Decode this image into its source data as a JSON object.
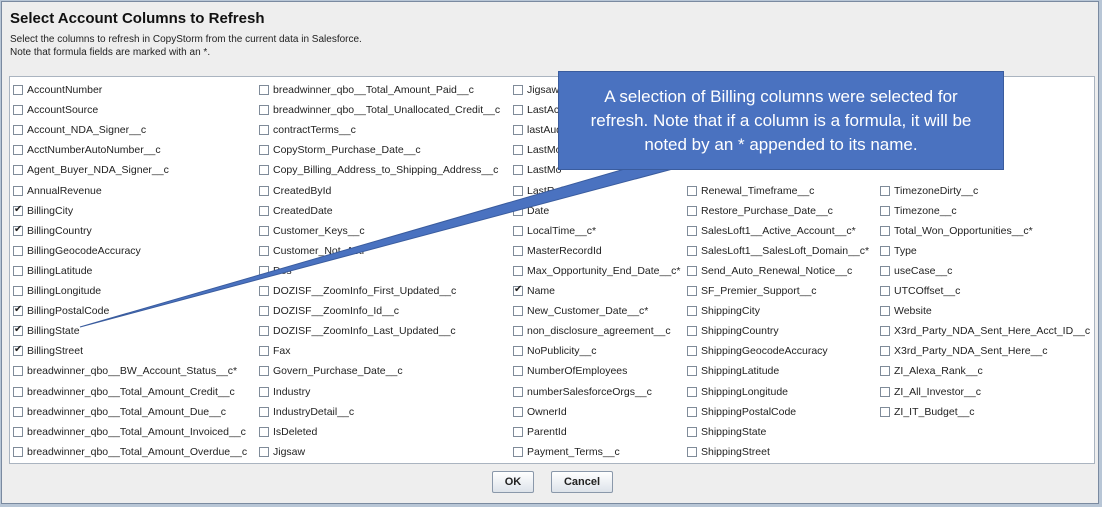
{
  "dialog": {
    "title": "Select Account Columns to Refresh",
    "description_line1": "Select the columns to refresh in CopyStorm from the current data in Salesforce.",
    "description_line2": "Note that formula fields are marked with an *.",
    "ok_label": "OK",
    "cancel_label": "Cancel"
  },
  "columns": [
    [
      {
        "label": "AccountNumber",
        "checked": false
      },
      {
        "label": "AccountSource",
        "checked": false
      },
      {
        "label": "Account_NDA_Signer__c",
        "checked": false
      },
      {
        "label": "AcctNumberAutoNumber__c",
        "checked": false
      },
      {
        "label": "Agent_Buyer_NDA_Signer__c",
        "checked": false
      },
      {
        "label": "AnnualRevenue",
        "checked": false
      },
      {
        "label": "BillingCity",
        "checked": true
      },
      {
        "label": "BillingCountry",
        "checked": true
      },
      {
        "label": "BillingGeocodeAccuracy",
        "checked": false
      },
      {
        "label": "BillingLatitude",
        "checked": false
      },
      {
        "label": "BillingLongitude",
        "checked": false
      },
      {
        "label": "BillingPostalCode",
        "checked": true
      },
      {
        "label": "BillingState",
        "checked": true
      },
      {
        "label": "BillingStreet",
        "checked": true
      },
      {
        "label": "breadwinner_qbo__BW_Account_Status__c*",
        "checked": false
      },
      {
        "label": "breadwinner_qbo__Total_Amount_Credit__c",
        "checked": false
      },
      {
        "label": "breadwinner_qbo__Total_Amount_Due__c",
        "checked": false
      },
      {
        "label": "breadwinner_qbo__Total_Amount_Invoiced__c",
        "checked": false
      },
      {
        "label": "breadwinner_qbo__Total_Amount_Overdue__c",
        "checked": false
      }
    ],
    [
      {
        "label": "breadwinner_qbo__Total_Amount_Paid__c",
        "checked": false
      },
      {
        "label": "breadwinner_qbo__Total_Unallocated_Credit__c",
        "checked": false
      },
      {
        "label": "contractTerms__c",
        "checked": false
      },
      {
        "label": "CopyStorm_Purchase_Date__c",
        "checked": false
      },
      {
        "label": "Copy_Billing_Address_to_Shipping_Address__c",
        "checked": false
      },
      {
        "label": "CreatedById",
        "checked": false
      },
      {
        "label": "CreatedDate",
        "checked": false
      },
      {
        "label": "Customer_Keys__c",
        "checked": false
      },
      {
        "label": "Customer_Not_Acti",
        "checked": false
      },
      {
        "label": "Des",
        "checked": false
      },
      {
        "label": "DOZISF__ZoomInfo_First_Updated__c",
        "checked": false
      },
      {
        "label": "DOZISF__ZoomInfo_Id__c",
        "checked": false
      },
      {
        "label": "DOZISF__ZoomInfo_Last_Updated__c",
        "checked": false
      },
      {
        "label": "Fax",
        "checked": false
      },
      {
        "label": "Govern_Purchase_Date__c",
        "checked": false
      },
      {
        "label": "Industry",
        "checked": false
      },
      {
        "label": "IndustryDetail__c",
        "checked": false
      },
      {
        "label": "IsDeleted",
        "checked": false
      },
      {
        "label": "Jigsaw",
        "checked": false
      }
    ],
    [
      {
        "label": "Jigsaw",
        "checked": false
      },
      {
        "label": "LastAc",
        "checked": false
      },
      {
        "label": "lastAud",
        "checked": false
      },
      {
        "label": "LastMo",
        "checked": false
      },
      {
        "label": "LastMo",
        "checked": false
      },
      {
        "label": "LastRefere",
        "checked": false
      },
      {
        "label": "Date",
        "checked": false
      },
      {
        "label": "LocalTime__c*",
        "checked": false
      },
      {
        "label": "MasterRecordId",
        "checked": false
      },
      {
        "label": "Max_Opportunity_End_Date__c*",
        "checked": false
      },
      {
        "label": "Name",
        "checked": true
      },
      {
        "label": "New_Customer_Date__c*",
        "checked": false
      },
      {
        "label": "non_disclosure_agreement__c",
        "checked": false
      },
      {
        "label": "NoPublicity__c",
        "checked": false
      },
      {
        "label": "NumberOfEmployees",
        "checked": false
      },
      {
        "label": "numberSalesforceOrgs__c",
        "checked": false
      },
      {
        "label": "OwnerId",
        "checked": false
      },
      {
        "label": "ParentId",
        "checked": false
      },
      {
        "label": "Payment_Terms__c",
        "checked": false
      }
    ],
    [
      {
        "label": "Renewal_Timeframe__c",
        "checked": false
      },
      {
        "label": "Restore_Purchase_Date__c",
        "checked": false
      },
      {
        "label": "SalesLoft1__Active_Account__c*",
        "checked": false
      },
      {
        "label": "SalesLoft1__SalesLoft_Domain__c*",
        "checked": false
      },
      {
        "label": "Send_Auto_Renewal_Notice__c",
        "checked": false
      },
      {
        "label": "SF_Premier_Support__c",
        "checked": false
      },
      {
        "label": "ShippingCity",
        "checked": false
      },
      {
        "label": "ShippingCountry",
        "checked": false
      },
      {
        "label": "ShippingGeocodeAccuracy",
        "checked": false
      },
      {
        "label": "ShippingLatitude",
        "checked": false
      },
      {
        "label": "ShippingLongitude",
        "checked": false
      },
      {
        "label": "ShippingPostalCode",
        "checked": false
      },
      {
        "label": "ShippingState",
        "checked": false
      },
      {
        "label": "ShippingStreet",
        "checked": false
      }
    ],
    [
      {
        "label": "TimezoneDirty__c",
        "checked": false
      },
      {
        "label": "Timezone__c",
        "checked": false
      },
      {
        "label": "Total_Won_Opportunities__c*",
        "checked": false
      },
      {
        "label": "Type",
        "checked": false
      },
      {
        "label": "useCase__c",
        "checked": false
      },
      {
        "label": "UTCOffset__c",
        "checked": false
      },
      {
        "label": "Website",
        "checked": false
      },
      {
        "label": "X3rd_Party_NDA_Sent_Here_Acct_ID__c",
        "checked": false
      },
      {
        "label": "X3rd_Party_NDA_Sent_Here__c",
        "checked": false
      },
      {
        "label": "ZI_Alexa_Rank__c",
        "checked": false
      },
      {
        "label": "ZI_All_Investor__c",
        "checked": false
      },
      {
        "label": "ZI_IT_Budget__c",
        "checked": false
      }
    ]
  ],
  "callout": {
    "line1": "A selection of Billing columns were selected for",
    "line2": "refresh. Note that if a column is a formula, it will be",
    "line3": "noted by an * appended to its name."
  },
  "colors": {
    "callout_fill": "#4a72c0",
    "dialog_bg": "#eeeeee"
  }
}
